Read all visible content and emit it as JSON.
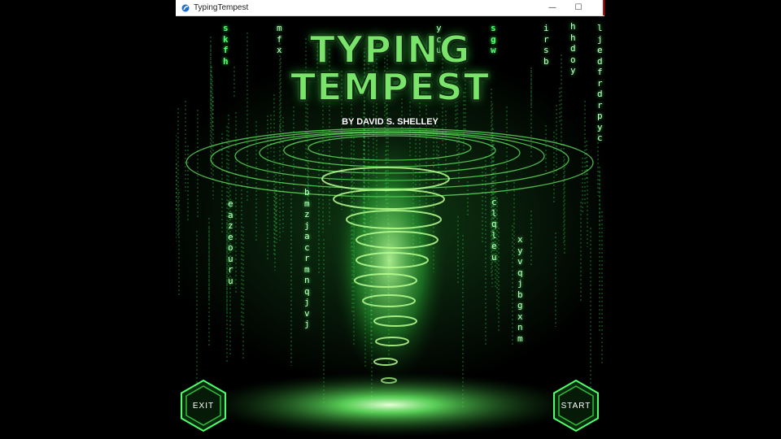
{
  "window": {
    "title": "TypingTempest",
    "controls": {
      "minimize": "—",
      "maximize": "☐",
      "close": ""
    }
  },
  "game": {
    "title_line1": "TYPING",
    "title_line2": "TEMPEST",
    "byline": "BY DAVID S. SHELLEY",
    "exit_label": "EXIT",
    "start_label": "START",
    "colors": {
      "accent": "#3cff5a",
      "title": "#79e36a",
      "background": "#000000"
    }
  },
  "falling_letters": [
    {
      "letters": [
        "s",
        "k",
        "f",
        "h"
      ]
    },
    {
      "letters": [
        "m",
        "f",
        "x"
      ]
    },
    {
      "letters": [
        "y",
        "c",
        "u"
      ]
    },
    {
      "letters": [
        "s",
        "g",
        "w"
      ]
    },
    {
      "letters": [
        "i",
        "r",
        "s",
        "b"
      ]
    },
    {
      "letters": [
        "h",
        "h",
        "d",
        "o",
        "y"
      ]
    },
    {
      "letters": [
        "l",
        "j",
        "e",
        "d",
        "f",
        "r",
        "d",
        "r",
        "p",
        "y",
        "c"
      ]
    },
    {
      "letters": [
        "e",
        "a",
        "z",
        "e",
        "o",
        "u",
        "r",
        "u"
      ]
    },
    {
      "letters": [
        "b",
        "m",
        "z",
        "j",
        "a",
        "c",
        "r",
        "m",
        "n",
        "q",
        "j",
        "v",
        "j"
      ]
    },
    {
      "letters": [
        "c",
        "l",
        "q",
        "l",
        "e",
        "u"
      ]
    },
    {
      "letters": [
        "x",
        "y",
        "v",
        "q",
        "j",
        "b",
        "g",
        "x",
        "n",
        "m"
      ]
    }
  ]
}
